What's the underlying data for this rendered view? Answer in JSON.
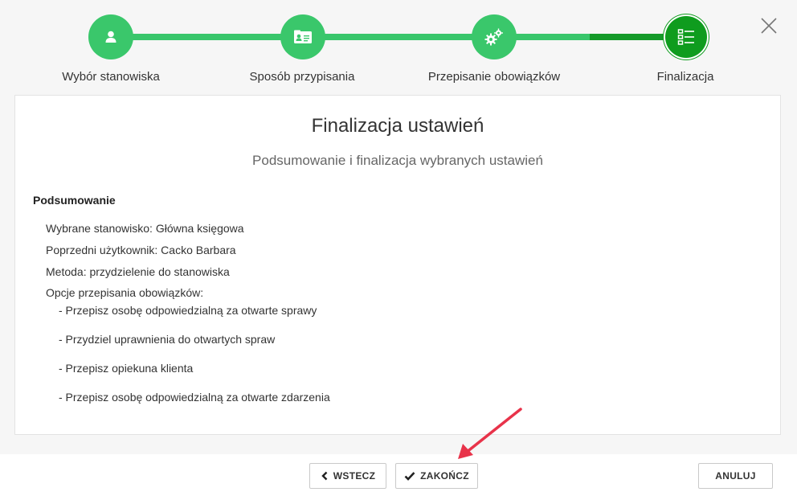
{
  "stepper": {
    "steps": [
      {
        "label": "Wybór stanowiska",
        "icon": "user-icon"
      },
      {
        "label": "Sposób przypisania",
        "icon": "id-card-icon"
      },
      {
        "label": "Przepisanie obowiązków",
        "icon": "gears-icon"
      },
      {
        "label": "Finalizacja",
        "icon": "checklist-icon"
      }
    ],
    "active_step": 4,
    "colors": {
      "completed": "#3ac76b",
      "active": "#0f9c1e"
    }
  },
  "close": {
    "icon": "close-icon"
  },
  "panel": {
    "title": "Finalizacja ustawień",
    "subtitle": "Podsumowanie i finalizacja wybranych ustawień",
    "summary_heading": "Podsumowanie",
    "lines": [
      "Wybrane stanowisko: Główna księgowa",
      "Poprzedni użytkownik: Cacko Barbara",
      "Metoda: przydzielenie do stanowiska",
      "Opcje przepisania obowiązków:"
    ],
    "options": [
      "- Przepisz osobę odpowiedzialną za otwarte sprawy",
      "- Przydziel uprawnienia do otwartych spraw",
      "- Przepisz opiekuna klienta",
      "- Przepisz osobę odpowiedzialną za otwarte zdarzenia"
    ]
  },
  "footer": {
    "back_label": "WSTECZ",
    "finish_label": "ZAKOŃCZ",
    "cancel_label": "ANULUJ"
  },
  "annotation": {
    "color": "#e8334a"
  }
}
